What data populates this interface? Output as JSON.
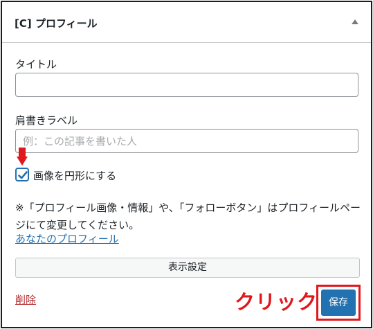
{
  "widget": {
    "title": "[C] プロフィール",
    "title_field": {
      "label": "タイトル",
      "value": "",
      "placeholder": ""
    },
    "caption_field": {
      "label": "肩書きラベル",
      "value": "",
      "placeholder": "例：この記事を書いた人"
    },
    "round_image_checkbox": {
      "label": "画像を円形にする",
      "checked": true
    },
    "note": "※「プロフィール画像・情報」や、「フォローボタン」はプロフィールページにて変更してください。",
    "profile_link": "あなたのプロフィール",
    "display_settings_button": "表示設定",
    "delete_link": "削除",
    "save_button": "保存"
  },
  "annotation": {
    "click_text": "クリック",
    "highlight_color": "#e0181c"
  },
  "colors": {
    "accent": "#2271b1",
    "delete": "#b32d2e",
    "annotation_red": "#e0181c"
  },
  "icons": {
    "collapse": "triangle-up-icon",
    "checkbox": "checkmark-icon",
    "pointer": "red-arrow-down-icon"
  }
}
